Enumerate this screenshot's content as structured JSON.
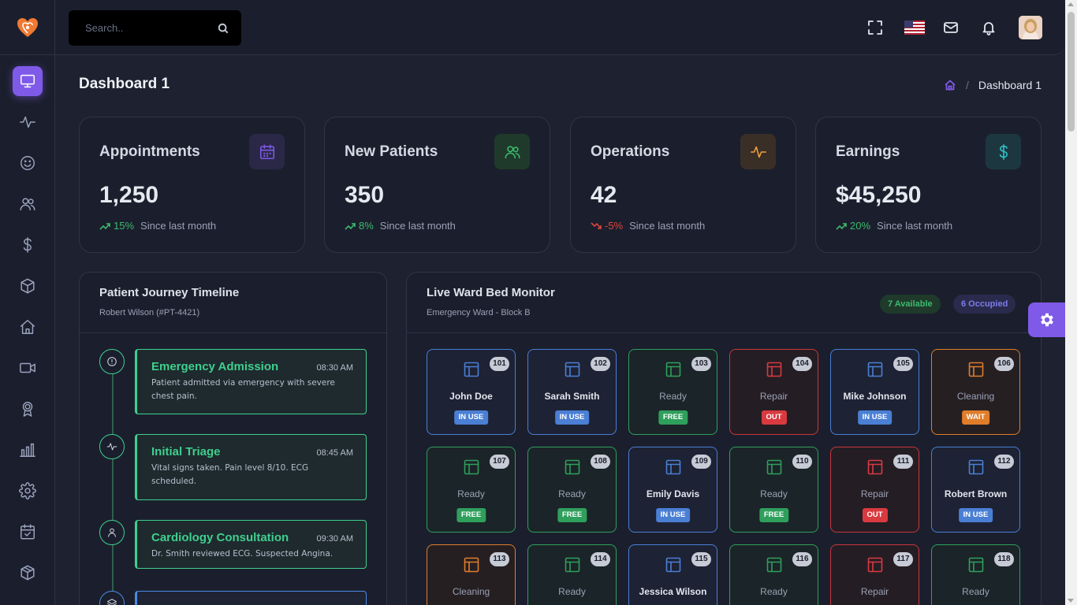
{
  "search": {
    "placeholder": "Search.."
  },
  "page": {
    "title": "Dashboard 1",
    "breadcrumb_current": "Dashboard 1",
    "breadcrumb_sep": "/"
  },
  "sidebar": {
    "items": [
      {
        "name": "monitor",
        "active": true
      },
      {
        "name": "activity"
      },
      {
        "name": "smile"
      },
      {
        "name": "users"
      },
      {
        "name": "dollar"
      },
      {
        "name": "box"
      },
      {
        "name": "home"
      },
      {
        "name": "video"
      },
      {
        "name": "award"
      },
      {
        "name": "bar-chart"
      },
      {
        "name": "settings"
      },
      {
        "name": "calendar-check"
      },
      {
        "name": "package"
      }
    ]
  },
  "stats": [
    {
      "label": "Appointments",
      "value": "1,250",
      "pct": "15%",
      "direction": "up",
      "since": "Since last month",
      "icon": "calendar-icon",
      "color": "#7f5ae8"
    },
    {
      "label": "New Patients",
      "value": "350",
      "pct": "8%",
      "direction": "up",
      "since": "Since last month",
      "icon": "users-icon",
      "color": "#3cba6d"
    },
    {
      "label": "Operations",
      "value": "42",
      "pct": "-5%",
      "direction": "down",
      "since": "Since last month",
      "icon": "activity-icon",
      "color": "#f0a23a"
    },
    {
      "label": "Earnings",
      "value": "$45,250",
      "pct": "20%",
      "direction": "up",
      "since": "Since last month",
      "icon": "dollar-icon",
      "color": "#2fc3c9"
    }
  ],
  "timeline": {
    "title": "Patient Journey Timeline",
    "subtitle": "Robert Wilson (#PT-4421)",
    "events": [
      {
        "title": "Emergency Admission",
        "time": "08:30 AM",
        "desc": "Patient admitted via emergency with severe chest pain.",
        "icon": "alert-icon"
      },
      {
        "title": "Initial Triage",
        "time": "08:45 AM",
        "desc": "Vital signs taken. Pain level 8/10. ECG scheduled.",
        "icon": "activity-icon"
      },
      {
        "title": "Cardiology Consultation",
        "time": "09:30 AM",
        "desc": "Dr. Smith reviewed ECG. Suspected Angina.",
        "icon": "user-icon"
      },
      {
        "title": "",
        "time": "",
        "desc": "",
        "icon": "layers-icon"
      }
    ]
  },
  "ward": {
    "title": "Live Ward Bed Monitor",
    "subtitle": "Emergency Ward - Block B",
    "available": "7 Available",
    "occupied": "6 Occupied",
    "beds": [
      {
        "num": "101",
        "name": "John Doe",
        "status": "IN USE",
        "type": "inuse"
      },
      {
        "num": "102",
        "name": "Sarah Smith",
        "status": "IN USE",
        "type": "inuse"
      },
      {
        "num": "103",
        "name": "Ready",
        "status": "FREE",
        "type": "free"
      },
      {
        "num": "104",
        "name": "Repair",
        "status": "OUT",
        "type": "out"
      },
      {
        "num": "105",
        "name": "Mike Johnson",
        "status": "IN USE",
        "type": "inuse"
      },
      {
        "num": "106",
        "name": "Cleaning",
        "status": "WAIT",
        "type": "wait"
      },
      {
        "num": "107",
        "name": "Ready",
        "status": "FREE",
        "type": "free"
      },
      {
        "num": "108",
        "name": "Ready",
        "status": "FREE",
        "type": "free"
      },
      {
        "num": "109",
        "name": "Emily Davis",
        "status": "IN USE",
        "type": "inuse"
      },
      {
        "num": "110",
        "name": "Ready",
        "status": "FREE",
        "type": "free"
      },
      {
        "num": "111",
        "name": "Repair",
        "status": "OUT",
        "type": "out"
      },
      {
        "num": "112",
        "name": "Robert Brown",
        "status": "IN USE",
        "type": "inuse"
      },
      {
        "num": "113",
        "name": "Cleaning",
        "status": "",
        "type": "wait"
      },
      {
        "num": "114",
        "name": "Ready",
        "status": "",
        "type": "free"
      },
      {
        "num": "115",
        "name": "Jessica Wilson",
        "status": "",
        "type": "inuse"
      },
      {
        "num": "116",
        "name": "Ready",
        "status": "",
        "type": "free"
      },
      {
        "num": "117",
        "name": "Repair",
        "status": "",
        "type": "out"
      },
      {
        "num": "118",
        "name": "Ready",
        "status": "",
        "type": "free"
      }
    ]
  },
  "colors": {
    "accent": "#7f5ae8",
    "success": "#3cba6d",
    "danger": "#e0443e",
    "warning": "#e07d2b",
    "info": "#4a7fd4"
  }
}
